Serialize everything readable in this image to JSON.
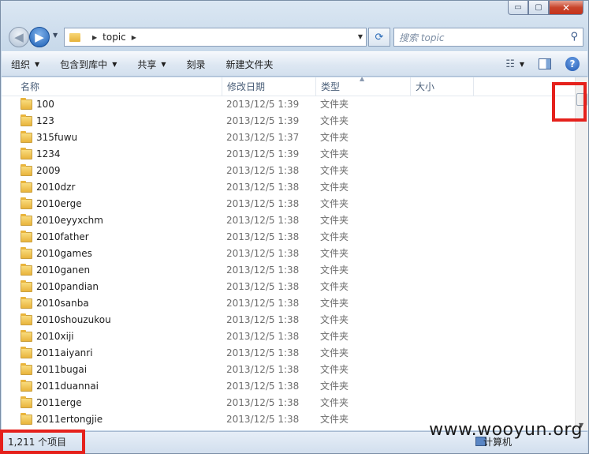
{
  "window": {
    "caption": {
      "minimize": "▭",
      "maximize": "▢",
      "close": "✕"
    }
  },
  "address": {
    "path": [
      "topic"
    ],
    "search_placeholder": "搜索 topic"
  },
  "toolbar": {
    "items": [
      {
        "label": "组织",
        "dropdown": true
      },
      {
        "label": "包含到库中",
        "dropdown": true
      },
      {
        "label": "共享",
        "dropdown": true
      },
      {
        "label": "刻录",
        "dropdown": false
      },
      {
        "label": "新建文件夹",
        "dropdown": false
      }
    ]
  },
  "columns": {
    "name": "名称",
    "date": "修改日期",
    "type": "类型",
    "size": "大小"
  },
  "files": [
    {
      "name": "100",
      "date": "2013/12/5 1:39",
      "type": "文件夹"
    },
    {
      "name": "123",
      "date": "2013/12/5 1:39",
      "type": "文件夹"
    },
    {
      "name": "315fuwu",
      "date": "2013/12/5 1:37",
      "type": "文件夹"
    },
    {
      "name": "1234",
      "date": "2013/12/5 1:39",
      "type": "文件夹"
    },
    {
      "name": "2009",
      "date": "2013/12/5 1:38",
      "type": "文件夹"
    },
    {
      "name": "2010dzr",
      "date": "2013/12/5 1:38",
      "type": "文件夹"
    },
    {
      "name": "2010erge",
      "date": "2013/12/5 1:38",
      "type": "文件夹"
    },
    {
      "name": "2010eyyxchm",
      "date": "2013/12/5 1:38",
      "type": "文件夹"
    },
    {
      "name": "2010father",
      "date": "2013/12/5 1:38",
      "type": "文件夹"
    },
    {
      "name": "2010games",
      "date": "2013/12/5 1:38",
      "type": "文件夹"
    },
    {
      "name": "2010ganen",
      "date": "2013/12/5 1:38",
      "type": "文件夹"
    },
    {
      "name": "2010pandian",
      "date": "2013/12/5 1:38",
      "type": "文件夹"
    },
    {
      "name": "2010sanba",
      "date": "2013/12/5 1:38",
      "type": "文件夹"
    },
    {
      "name": "2010shouzukou",
      "date": "2013/12/5 1:38",
      "type": "文件夹"
    },
    {
      "name": "2010xiji",
      "date": "2013/12/5 1:38",
      "type": "文件夹"
    },
    {
      "name": "2011aiyanri",
      "date": "2013/12/5 1:38",
      "type": "文件夹"
    },
    {
      "name": "2011bugai",
      "date": "2013/12/5 1:38",
      "type": "文件夹"
    },
    {
      "name": "2011duannai",
      "date": "2013/12/5 1:38",
      "type": "文件夹"
    },
    {
      "name": "2011erge",
      "date": "2013/12/5 1:38",
      "type": "文件夹"
    },
    {
      "name": "2011ertongjie",
      "date": "2013/12/5 1:38",
      "type": "文件夹"
    }
  ],
  "status": {
    "count": "1,211 个项目",
    "computer": "计算机"
  },
  "watermark": "www.wooyun.org",
  "colors": {
    "annotation_red": "#e5211c",
    "folder": "#e9b43c"
  }
}
